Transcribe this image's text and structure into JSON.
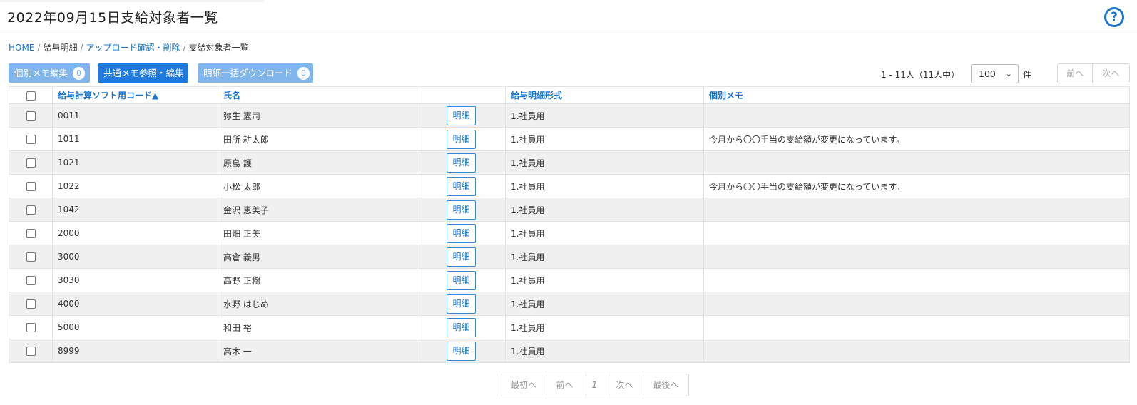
{
  "header": {
    "title": "2022年09月15日支給対象者一覧",
    "help_icon": "question-circle-icon",
    "help_glyph": "?"
  },
  "breadcrumb": {
    "home": "HOME",
    "sep": "/",
    "payslip": "給与明細",
    "upload": "アップロード確認・削除",
    "current": "支給対象者一覧"
  },
  "toolbar": {
    "memo_label": "個別メモ編集",
    "memo_count": "0",
    "shared_label": "共通メモ参照・編集",
    "download_label": "明細一括ダウンロード",
    "download_count": "0",
    "range_text": "1 - 11人（11人中）",
    "per_page": "100",
    "per_page_unit": "件",
    "prev": "前へ",
    "next": "次へ"
  },
  "table": {
    "columns": {
      "code": "給与計算ソフト用コード▲",
      "name": "氏名",
      "detail": "",
      "format": "給与明細形式",
      "memo": "個別メモ"
    },
    "detail_label": "明細",
    "rows": [
      {
        "code": "0011",
        "name": "弥生 憲司",
        "format": "1.社員用",
        "memo": ""
      },
      {
        "code": "1011",
        "name": "田所 耕太郎",
        "format": "1.社員用",
        "memo": "今月から〇〇手当の支給額が変更になっています。"
      },
      {
        "code": "1021",
        "name": "原島 護",
        "format": "1.社員用",
        "memo": ""
      },
      {
        "code": "1022",
        "name": "小松 太郎",
        "format": "1.社員用",
        "memo": "今月から〇〇手当の支給額が変更になっています。"
      },
      {
        "code": "1042",
        "name": "金沢 恵美子",
        "format": "1.社員用",
        "memo": ""
      },
      {
        "code": "2000",
        "name": "田畑 正美",
        "format": "1.社員用",
        "memo": ""
      },
      {
        "code": "3000",
        "name": "高倉 義男",
        "format": "1.社員用",
        "memo": ""
      },
      {
        "code": "3030",
        "name": "高野 正樹",
        "format": "1.社員用",
        "memo": ""
      },
      {
        "code": "4000",
        "name": "水野 はじめ",
        "format": "1.社員用",
        "memo": ""
      },
      {
        "code": "5000",
        "name": "和田 裕",
        "format": "1.社員用",
        "memo": ""
      },
      {
        "code": "8999",
        "name": "高木 一",
        "format": "1.社員用",
        "memo": ""
      }
    ]
  },
  "pager": {
    "first": "最初へ",
    "prev": "前へ",
    "page": "1",
    "next": "次へ",
    "last": "最後へ"
  }
}
